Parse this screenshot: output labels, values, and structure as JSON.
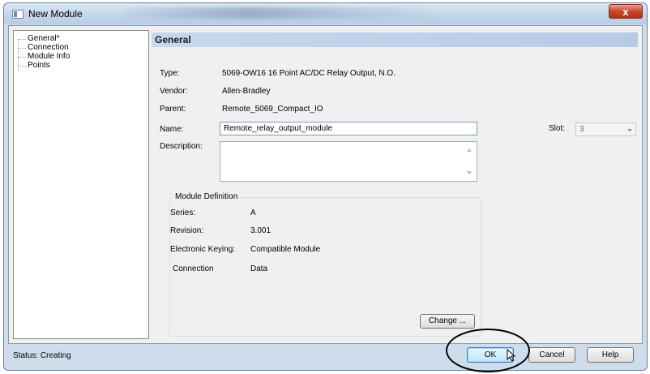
{
  "window": {
    "title": "New Module",
    "close_symbol": "x"
  },
  "tree": {
    "items": [
      {
        "label": "General*"
      },
      {
        "label": "Connection"
      },
      {
        "label": "Module Info"
      },
      {
        "label": "Points"
      }
    ]
  },
  "general": {
    "section_title": "General",
    "type_label": "Type:",
    "type_value": "5069-OW16 16 Point AC/DC Relay Output, N.O.",
    "vendor_label": "Vendor:",
    "vendor_value": "Allen-Bradley",
    "parent_label": "Parent:",
    "parent_value": "Remote_5069_Compact_IO",
    "name_label": "Name:",
    "name_value": "Remote_relay_output_module",
    "description_label": "Description:",
    "description_value": "",
    "slot_label": "Slot:",
    "slot_value": "3"
  },
  "module_definition": {
    "group_label": "Module Definition",
    "series_label": "Series:",
    "series_value": "A",
    "revision_label": "Revision:",
    "revision_value": "3.001",
    "keying_label": "Electronic Keying:",
    "keying_value": "Compatible Module",
    "connection_label": "Connection",
    "connection_value": "Data",
    "change_button": "Change ..."
  },
  "status": {
    "text": "Status: Creating"
  },
  "buttons": {
    "ok": "OK",
    "cancel": "Cancel",
    "help": "Help"
  },
  "icons": [
    "window-icon",
    "close-icon",
    "scroll-up-icon",
    "scroll-down-icon",
    "dropdown-arrow-icon",
    "mouse-cursor-icon"
  ]
}
